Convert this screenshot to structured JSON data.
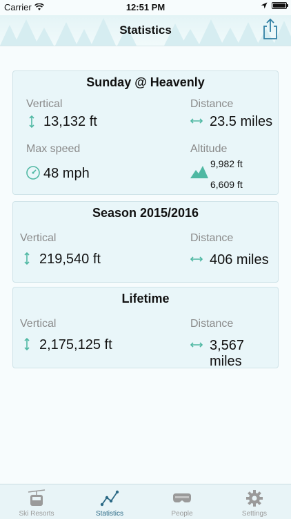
{
  "status": {
    "carrier": "Carrier",
    "time": "12:51 PM"
  },
  "nav": {
    "title": "Statistics"
  },
  "day": {
    "title": "Sunday @ Heavenly",
    "vertical_label": "Vertical",
    "vertical_value": "13,132 ft",
    "distance_label": "Distance",
    "distance_value": "23.5 miles",
    "maxspeed_label": "Max speed",
    "maxspeed_value": "48 mph",
    "altitude_label": "Altitude",
    "altitude_high": "9,982 ft",
    "altitude_low": "6,609 ft"
  },
  "season": {
    "title": "Season 2015/2016",
    "vertical_label": "Vertical",
    "vertical_value": "219,540 ft",
    "distance_label": "Distance",
    "distance_value": "406 miles"
  },
  "lifetime": {
    "title": "Lifetime",
    "vertical_label": "Vertical",
    "vertical_value": "2,175,125 ft",
    "distance_label": "Distance",
    "distance_value": "3,567 miles"
  },
  "tabs": [
    {
      "label": "Ski Resorts",
      "icon": "gondola-icon"
    },
    {
      "label": "Statistics",
      "icon": "stats-graph-icon",
      "active": true
    },
    {
      "label": "People",
      "icon": "goggles-icon"
    },
    {
      "label": "Settings",
      "icon": "gear-icon"
    }
  ],
  "colors": {
    "accent": "#4fb8a3",
    "active_tab": "#2c6a86",
    "label": "#8a8a8a"
  }
}
